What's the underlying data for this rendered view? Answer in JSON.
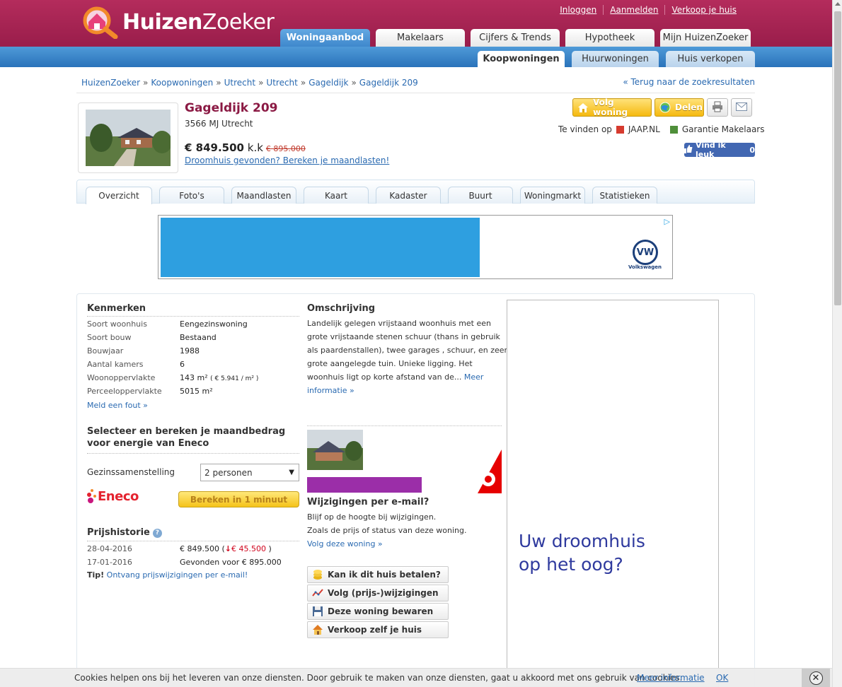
{
  "header": {
    "logo_bold": "Huizen",
    "logo_thin": "Zoeker",
    "top_links": [
      "Inloggen",
      "Aanmelden",
      "Verkoop je huis"
    ],
    "main_tabs": [
      "Woningaanbod",
      "Makelaars",
      "Cijfers & Trends",
      "Hypotheek",
      "Mijn HuizenZoeker"
    ],
    "sub_tabs": [
      "Koopwoningen",
      "Huurwoningen",
      "Huis verkopen"
    ]
  },
  "breadcrumb": {
    "items": [
      "HuizenZoeker",
      "Koopwoningen",
      "Utrecht",
      "Utrecht",
      "Gageldijk",
      "Gageldijk 209"
    ],
    "separator": "»",
    "back_link": "« Terug naar de zoekresultaten"
  },
  "property": {
    "title": "Gageldijk 209",
    "address": "3566 MJ Utrecht",
    "price": "€ 849.500",
    "price_suffix": "k.k",
    "old_price": "€ 895.000",
    "price_link": "Droomhuis gevonden? Bereken je maandlasten!"
  },
  "actions": {
    "follow": "Volg woning",
    "share": "Delen",
    "found_on_label": "Te vinden op",
    "found_on_1": "JAAP.NL",
    "found_on_2": "Garantie Makelaars",
    "fb_label": "Vind ik leuk",
    "fb_count": "0"
  },
  "detail_tabs": [
    "Overzicht",
    "Foto's",
    "Maandlasten",
    "Kaart",
    "Kadaster",
    "Buurt",
    "Woningmarkt",
    "Statistieken"
  ],
  "ad": {
    "brand": "Volkswagen",
    "choice": "▷"
  },
  "kenmerken": {
    "title": "Kenmerken",
    "rows": [
      {
        "label": "Soort woonhuis",
        "value": "Eengezinswoning"
      },
      {
        "label": "Soort bouw",
        "value": "Bestaand"
      },
      {
        "label": "Bouwjaar",
        "value": "1988"
      },
      {
        "label": "Aantal kamers",
        "value": "6"
      },
      {
        "label": "Woonoppervlakte",
        "value": "143 m²",
        "extra": "( € 5.941 / m² )"
      },
      {
        "label": "Perceeloppervlakte",
        "value": "5015 m²"
      }
    ],
    "report_link": "Meld een fout »"
  },
  "energy": {
    "title_line1": "Selecteer en bereken je maandbedrag",
    "title_line2": "voor energie van Eneco",
    "household_label": "Gezinssamenstelling",
    "household_value": "2 personen",
    "eneco_logo": "Eneco",
    "calc_button": "Bereken in 1 minuut"
  },
  "price_history": {
    "title": "Prijshistorie",
    "rows": [
      {
        "date": "28-04-2016",
        "value": "€ 849.500 (",
        "change": "€ 45.500",
        "close": " )"
      },
      {
        "date": "17-01-2016",
        "value": "Gevonden voor € 895.000"
      }
    ],
    "tip_label": "Tip!",
    "tip_link": "Ontvang prijswijzigingen per e-mail!"
  },
  "description": {
    "title": "Omschrijving",
    "lines": [
      "Landelijk gelegen vrijstaand woonhuis met een",
      "grote vrijstaande stenen schuur (thans in gebruik",
      "als paardenstallen), twee garages , schuur, en zeer",
      "grote aangelegde tuin. Unieke ligging. Het",
      "woonhuis ligt op korte afstand van de..."
    ],
    "more_1": "Meer",
    "more_2": "informatie »"
  },
  "alerts": {
    "title": "Wijzigingen per e-mail?",
    "line1": "Blijf op de hoogte bij wijzigingen.",
    "line2": "Zoals de prijs of status van deze woning.",
    "link": "Volg deze woning »"
  },
  "side_buttons": [
    "Kan ik dit huis betalen?",
    "Volg (prijs-)wijzigingen",
    "Deze woning bewaren",
    "Verkoop zelf je huis"
  ],
  "right_ad": {
    "line1": "Uw droomhuis",
    "line2": "op het oog?"
  },
  "cookie": {
    "text": "Cookies helpen ons bij het leveren van onze diensten. Door gebruik te maken van onze diensten, gaat u akkoord met ons gebruik van cookies.",
    "more": "Meer informatie",
    "ok": "OK",
    "close": "✕"
  },
  "colors": {
    "brand": "#9d1f4d",
    "blue": "#2a73bb",
    "link": "#2a6ab1"
  }
}
